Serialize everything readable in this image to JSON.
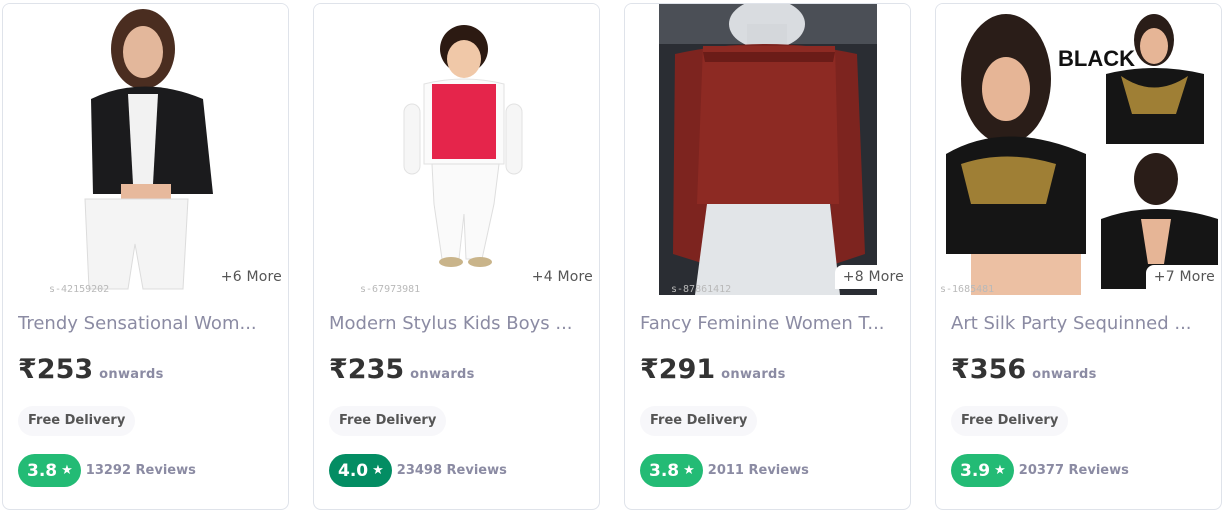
{
  "products": [
    {
      "title": "Trendy Sensational Wom...",
      "price": "₹253",
      "onwards": "onwards",
      "delivery": "Free Delivery",
      "rating": "3.8",
      "rating_color": "#23bb75",
      "reviews": "13292 Reviews",
      "more": "+6 More",
      "sku": "s-42159202"
    },
    {
      "title": "Modern Stylus Kids Boys ...",
      "price": "₹235",
      "onwards": "onwards",
      "delivery": "Free Delivery",
      "rating": "4.0",
      "rating_color": "#038d63",
      "reviews": "23498 Reviews",
      "more": "+4 More",
      "sku": "s-67973981"
    },
    {
      "title": "Fancy Feminine Women T...",
      "price": "₹291",
      "onwards": "onwards",
      "delivery": "Free Delivery",
      "rating": "3.8",
      "rating_color": "#23bb75",
      "reviews": "2011 Reviews",
      "more": "+8 More",
      "sku": "s-87861412"
    },
    {
      "title": "Art Silk Party Sequinned ...",
      "price": "₹356",
      "onwards": "onwards",
      "delivery": "Free Delivery",
      "rating": "3.9",
      "rating_color": "#23bb75",
      "reviews": "20377 Reviews",
      "more": "+7 More",
      "sku": "s-1685481",
      "image_text": "BLACK"
    }
  ]
}
